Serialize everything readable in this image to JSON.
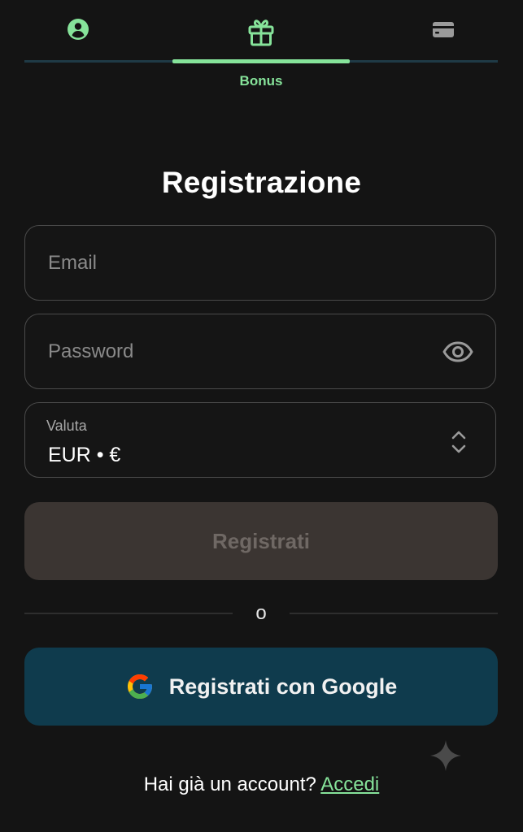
{
  "tabs": {
    "items": [
      {
        "id": "profile",
        "icon": "user-circle-icon",
        "label": ""
      },
      {
        "id": "bonus",
        "icon": "gift-icon",
        "label": "Bonus",
        "active": true
      },
      {
        "id": "payment",
        "icon": "credit-card-icon",
        "label": ""
      }
    ],
    "active_label": "Bonus",
    "accent_color": "#86e39a"
  },
  "form": {
    "title": "Registrazione",
    "email": {
      "placeholder": "Email",
      "value": ""
    },
    "password": {
      "placeholder": "Password",
      "value": "",
      "toggle_icon": "eye-icon"
    },
    "currency": {
      "label": "Valuta",
      "value": "EUR • €",
      "icon": "chevron-up-down-icon"
    },
    "register_label": "Registrati",
    "divider_text": "o",
    "google_label": "Registrati con Google",
    "google_icon": "google-logo-icon"
  },
  "footer": {
    "question": "Hai già un account?",
    "login_label": "Accedi"
  },
  "colors": {
    "background": "#141414",
    "accent": "#86e39a",
    "google_button": "#0f3b4d",
    "register_button_disabled": "#3b3532"
  }
}
